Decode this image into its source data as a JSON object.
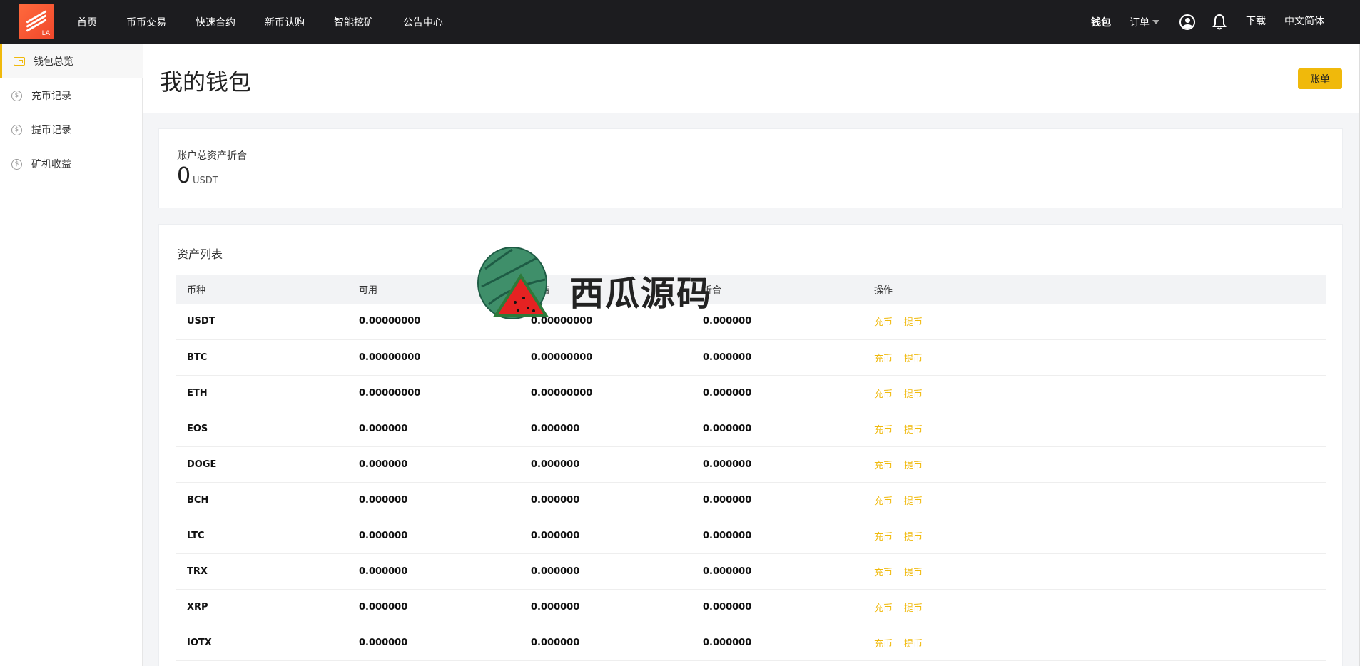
{
  "brand": {
    "logo_text": "LA",
    "accent": "#f0b90b",
    "topbar_bg": "#1c1c1f"
  },
  "nav": {
    "items": [
      "首页",
      "币币交易",
      "快速合约",
      "新币认购",
      "智能挖矿",
      "公告中心"
    ],
    "wallet": "钱包",
    "orders": "订单",
    "download": "下载",
    "language": "中文简体",
    "user_icon": "user-icon",
    "bell_icon": "bell-icon"
  },
  "sidebar": {
    "items": [
      {
        "label": "钱包总览",
        "icon": "wallet-icon",
        "active": true
      },
      {
        "label": "充币记录",
        "icon": "dollar-icon",
        "active": false
      },
      {
        "label": "提币记录",
        "icon": "dollar-icon",
        "active": false
      },
      {
        "label": "矿机收益",
        "icon": "dollar-icon",
        "active": false
      }
    ]
  },
  "header": {
    "title": "我的钱包",
    "bill_button": "账单"
  },
  "summary": {
    "label": "账户总资产折合",
    "value": "0",
    "unit": "USDT"
  },
  "assets": {
    "title": "资产列表",
    "columns": [
      "币种",
      "可用",
      "冻结",
      "折合",
      "操作"
    ],
    "deposit_label": "充币",
    "withdraw_label": "提币",
    "rows": [
      {
        "coin": "USDT",
        "available": "0.00000000",
        "frozen": "0.00000000",
        "equiv": "0.000000"
      },
      {
        "coin": "BTC",
        "available": "0.00000000",
        "frozen": "0.00000000",
        "equiv": "0.000000"
      },
      {
        "coin": "ETH",
        "available": "0.00000000",
        "frozen": "0.00000000",
        "equiv": "0.000000"
      },
      {
        "coin": "EOS",
        "available": "0.000000",
        "frozen": "0.000000",
        "equiv": "0.000000"
      },
      {
        "coin": "DOGE",
        "available": "0.000000",
        "frozen": "0.000000",
        "equiv": "0.000000"
      },
      {
        "coin": "BCH",
        "available": "0.000000",
        "frozen": "0.000000",
        "equiv": "0.000000"
      },
      {
        "coin": "LTC",
        "available": "0.000000",
        "frozen": "0.000000",
        "equiv": "0.000000"
      },
      {
        "coin": "TRX",
        "available": "0.000000",
        "frozen": "0.000000",
        "equiv": "0.000000"
      },
      {
        "coin": "XRP",
        "available": "0.000000",
        "frozen": "0.000000",
        "equiv": "0.000000"
      },
      {
        "coin": "IOTX",
        "available": "0.000000",
        "frozen": "0.000000",
        "equiv": "0.000000"
      }
    ]
  },
  "watermark": {
    "text": "西瓜源码",
    "icon": "watermelon-icon"
  }
}
